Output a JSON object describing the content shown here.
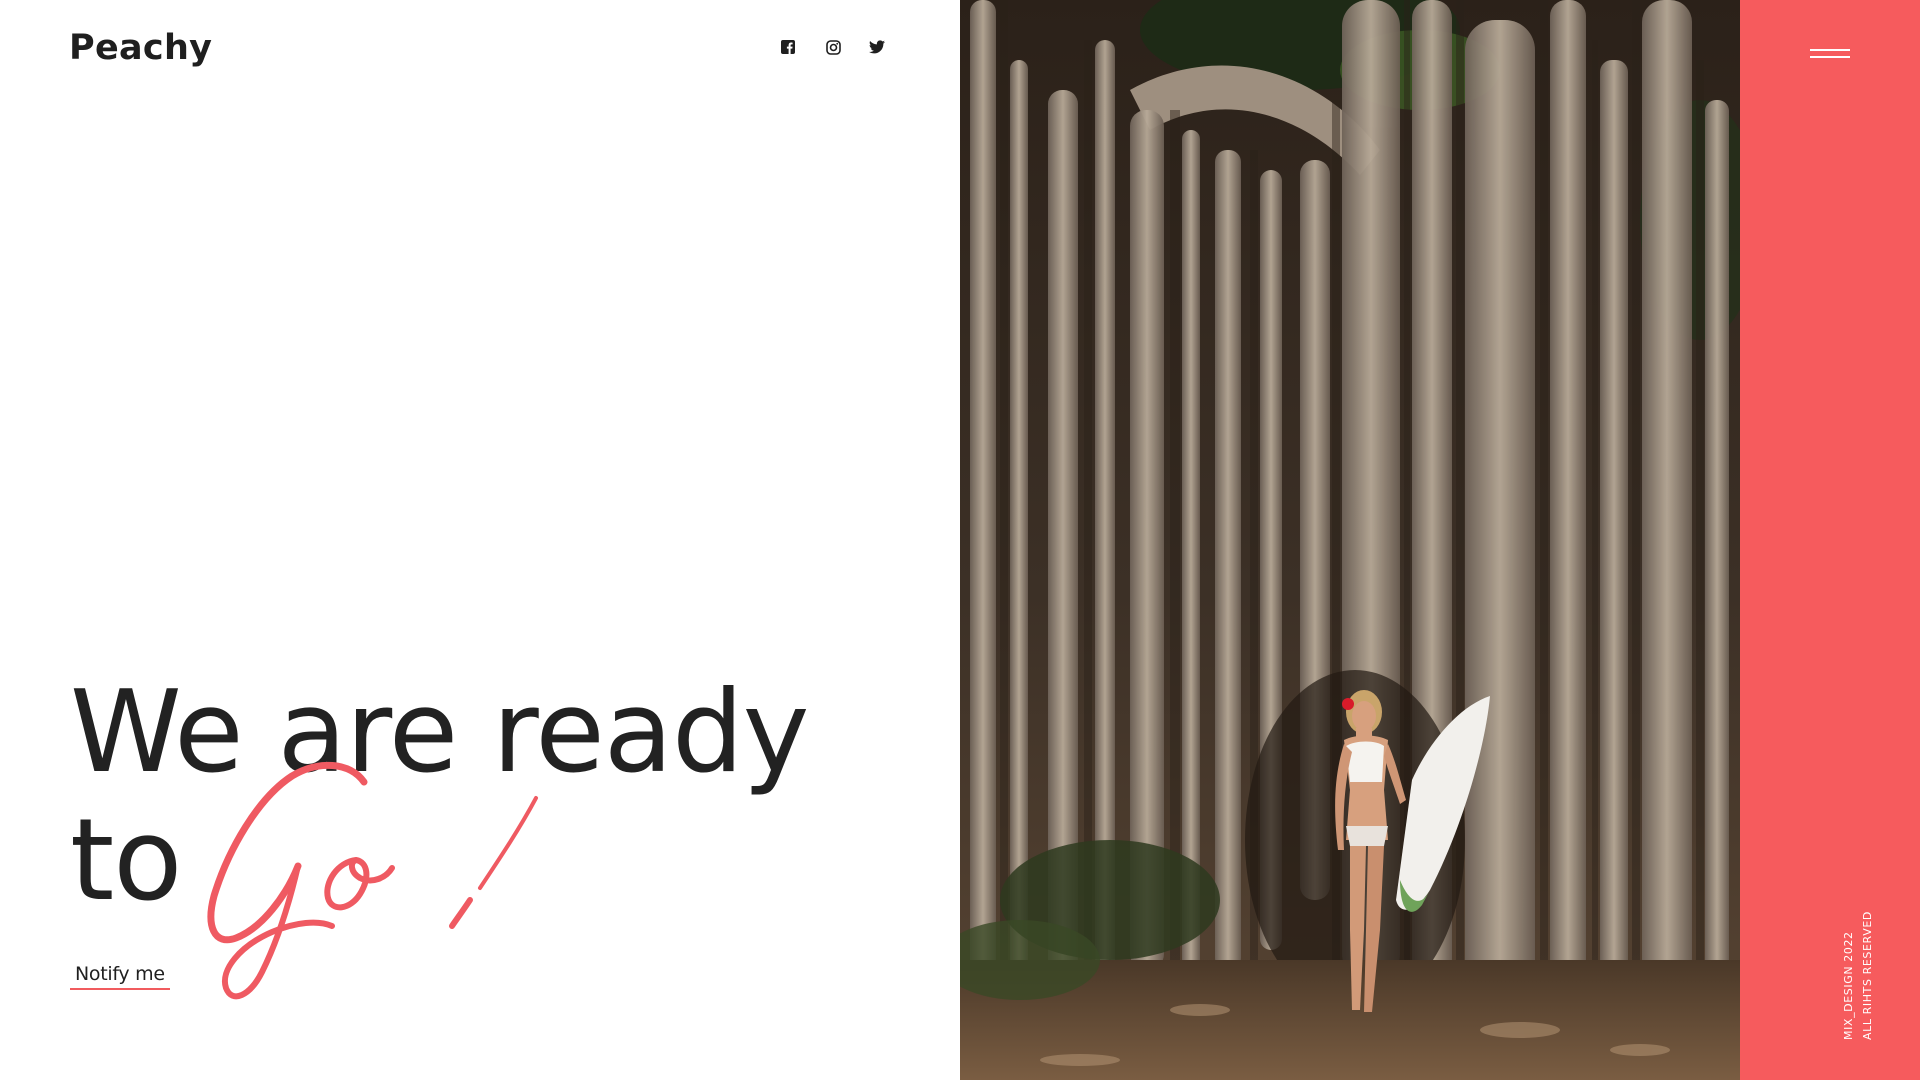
{
  "brand": {
    "name": "Peachy"
  },
  "header": {
    "social": [
      {
        "icon": "facebook-icon"
      },
      {
        "icon": "instagram-icon"
      },
      {
        "icon": "twitter-icon"
      }
    ]
  },
  "hero": {
    "headline_line1": "We are ready",
    "headline_line2": "to",
    "script_word": "Go!",
    "cta_label": "Notify me"
  },
  "sidebar": {
    "menu_icon": "hamburger-menu-icon",
    "copyright_line1": "MIX_DESIGN 2022",
    "copyright_line2": "ALL RIHTS RESERVED"
  },
  "colors": {
    "accent": "#f65b5d",
    "script": "#ef5a62",
    "text": "#222222",
    "background": "#ffffff"
  }
}
